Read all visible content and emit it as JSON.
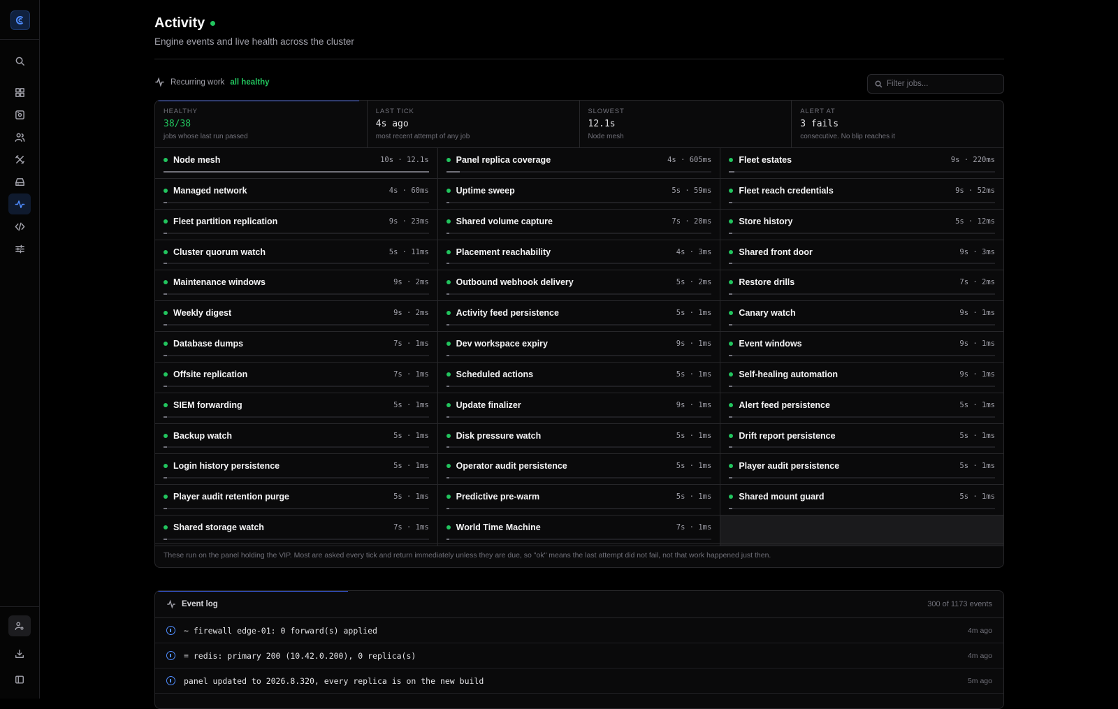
{
  "page": {
    "title": "Activity",
    "subtitle": "Engine events and live health across the cluster"
  },
  "recurring": {
    "label": "Recurring work",
    "status": "all healthy",
    "filter_placeholder": "Filter jobs...",
    "stats": [
      {
        "label": "HEALTHY",
        "value": "38/38",
        "desc": "jobs whose last run passed",
        "accent": "#22c55e"
      },
      {
        "label": "LAST TICK",
        "value": "4s ago",
        "desc": "most recent attempt of any job"
      },
      {
        "label": "SLOWEST",
        "value": "12.1s",
        "desc": "Node mesh"
      },
      {
        "label": "ALERT AT",
        "value": "3 fails",
        "desc": "consecutive. No blip reaches it"
      }
    ],
    "jobs": [
      {
        "name": "Node mesh",
        "meta": "10s · 12.1s",
        "bar": 1.0
      },
      {
        "name": "Panel replica coverage",
        "meta": "4s · 605ms",
        "bar": 0.05
      },
      {
        "name": "Fleet estates",
        "meta": "9s · 220ms",
        "bar": 0.02
      },
      {
        "name": "Managed network",
        "meta": "4s · 60ms",
        "bar": 0.01
      },
      {
        "name": "Uptime sweep",
        "meta": "5s · 59ms",
        "bar": 0.01
      },
      {
        "name": "Fleet reach credentials",
        "meta": "9s · 52ms",
        "bar": 0.01
      },
      {
        "name": "Fleet partition replication",
        "meta": "9s · 23ms",
        "bar": 0.01
      },
      {
        "name": "Shared volume capture",
        "meta": "7s · 20ms",
        "bar": 0.01
      },
      {
        "name": "Store history",
        "meta": "5s · 12ms",
        "bar": 0.01
      },
      {
        "name": "Cluster quorum watch",
        "meta": "5s · 11ms",
        "bar": 0.01
      },
      {
        "name": "Placement reachability",
        "meta": "4s · 3ms",
        "bar": 0.01
      },
      {
        "name": "Shared front door",
        "meta": "9s · 3ms",
        "bar": 0.01
      },
      {
        "name": "Maintenance windows",
        "meta": "9s · 2ms",
        "bar": 0.01
      },
      {
        "name": "Outbound webhook delivery",
        "meta": "5s · 2ms",
        "bar": 0.01
      },
      {
        "name": "Restore drills",
        "meta": "7s · 2ms",
        "bar": 0.01
      },
      {
        "name": "Weekly digest",
        "meta": "9s · 2ms",
        "bar": 0.01
      },
      {
        "name": "Activity feed persistence",
        "meta": "5s · 1ms",
        "bar": 0.01
      },
      {
        "name": "Canary watch",
        "meta": "9s · 1ms",
        "bar": 0.01
      },
      {
        "name": "Database dumps",
        "meta": "7s · 1ms",
        "bar": 0.01
      },
      {
        "name": "Dev workspace expiry",
        "meta": "9s · 1ms",
        "bar": 0.01
      },
      {
        "name": "Event windows",
        "meta": "9s · 1ms",
        "bar": 0.01
      },
      {
        "name": "Offsite replication",
        "meta": "7s · 1ms",
        "bar": 0.01
      },
      {
        "name": "Scheduled actions",
        "meta": "5s · 1ms",
        "bar": 0.01
      },
      {
        "name": "Self-healing automation",
        "meta": "9s · 1ms",
        "bar": 0.01
      },
      {
        "name": "SIEM forwarding",
        "meta": "5s · 1ms",
        "bar": 0.01
      },
      {
        "name": "Update finalizer",
        "meta": "9s · 1ms",
        "bar": 0.01
      },
      {
        "name": "Alert feed persistence",
        "meta": "5s · 1ms",
        "bar": 0.01
      },
      {
        "name": "Backup watch",
        "meta": "5s · 1ms",
        "bar": 0.01
      },
      {
        "name": "Disk pressure watch",
        "meta": "5s · 1ms",
        "bar": 0.01
      },
      {
        "name": "Drift report persistence",
        "meta": "5s · 1ms",
        "bar": 0.01
      },
      {
        "name": "Login history persistence",
        "meta": "5s · 1ms",
        "bar": 0.01
      },
      {
        "name": "Operator audit persistence",
        "meta": "5s · 1ms",
        "bar": 0.01
      },
      {
        "name": "Player audit persistence",
        "meta": "5s · 1ms",
        "bar": 0.01
      },
      {
        "name": "Player audit retention purge",
        "meta": "5s · 1ms",
        "bar": 0.01
      },
      {
        "name": "Predictive pre-warm",
        "meta": "5s · 1ms",
        "bar": 0.01
      },
      {
        "name": "Shared mount guard",
        "meta": "5s · 1ms",
        "bar": 0.01
      },
      {
        "name": "Shared storage watch",
        "meta": "7s · 1ms",
        "bar": 0.01
      },
      {
        "name": "World Time Machine",
        "meta": "7s · 1ms",
        "bar": 0.01
      }
    ],
    "footnote": "These run on the panel holding the VIP. Most are asked every tick and return immediately unless they are due, so \"ok\" means the last attempt did not fail, not that work happened just then."
  },
  "event_log": {
    "title": "Event log",
    "count": "300 of 1173 events",
    "rows": [
      {
        "message": "~ firewall edge-01: 0 forward(s) applied",
        "time": "4m ago"
      },
      {
        "message": "= redis: primary 200 (10.42.0.200), 0 replica(s)",
        "time": "4m ago"
      },
      {
        "message": "panel updated to 2026.8.320, every replica is on the new build",
        "time": "5m ago"
      }
    ]
  },
  "colors": {
    "accent": "#4f8cff",
    "healthy": "#22c55e",
    "background": "#000000"
  }
}
